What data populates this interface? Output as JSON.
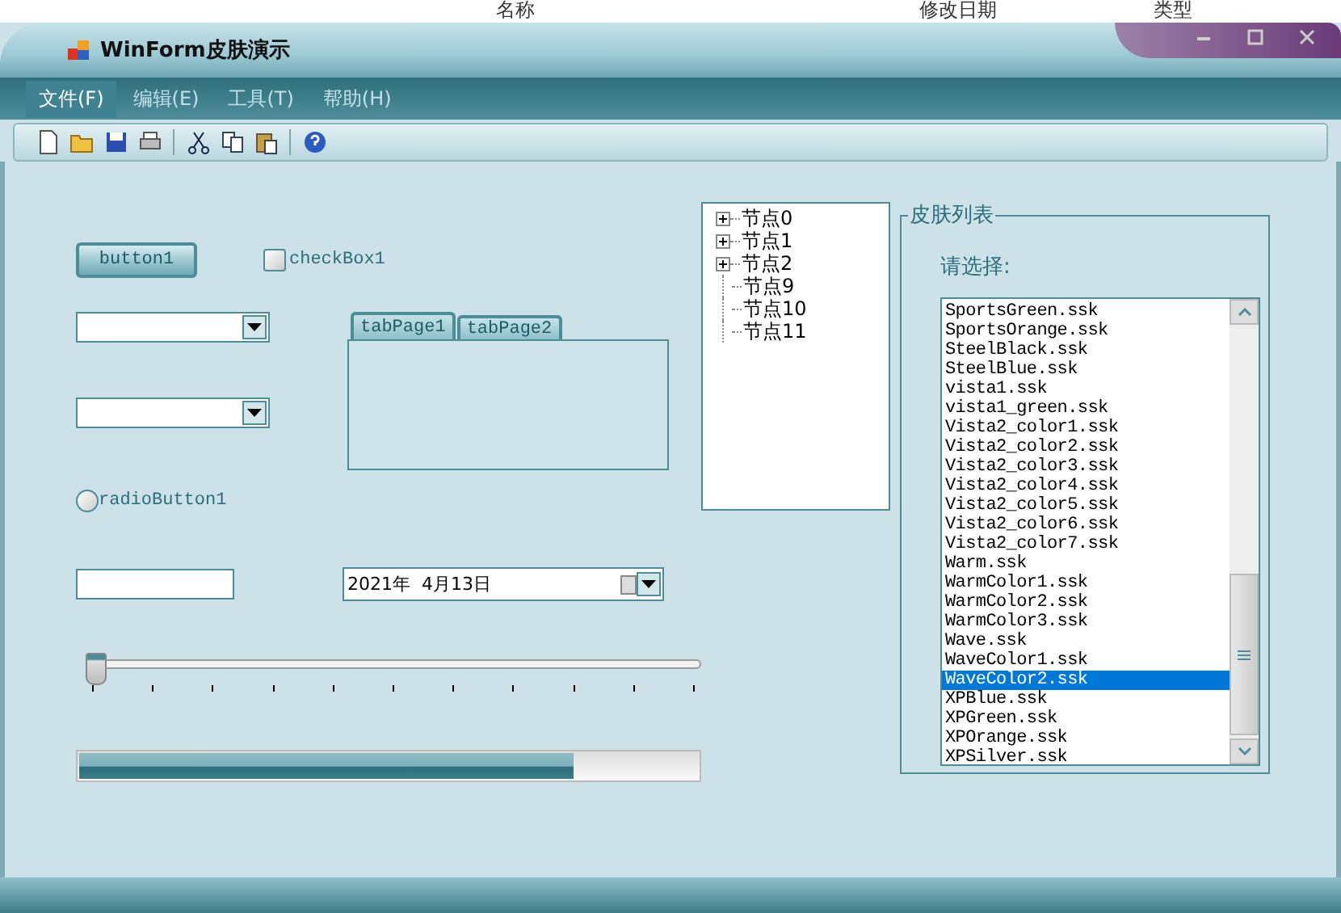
{
  "background_window": {
    "columns": [
      "名称",
      "修改日期",
      "类型"
    ]
  },
  "window": {
    "title": "WinForm皮肤演示"
  },
  "menu": [
    {
      "label": "文件(F)",
      "selected": true
    },
    {
      "label": "编辑(E)",
      "selected": false
    },
    {
      "label": "工具(T)",
      "selected": false
    },
    {
      "label": "帮助(H)",
      "selected": false
    }
  ],
  "toolbar": [
    {
      "kind": "new"
    },
    {
      "kind": "open"
    },
    {
      "kind": "save"
    },
    {
      "kind": "print"
    },
    {
      "kind": "separator"
    },
    {
      "kind": "cut"
    },
    {
      "kind": "copy"
    },
    {
      "kind": "paste"
    },
    {
      "kind": "separator"
    },
    {
      "kind": "help"
    }
  ],
  "button": {
    "label": "button1"
  },
  "checkbox": {
    "label": "checkBox1",
    "checked": false
  },
  "tabs": [
    {
      "label": "tabPage1",
      "selected": true
    },
    {
      "label": "tabPage2",
      "selected": false
    }
  ],
  "radio": {
    "label": "radioButton1",
    "checked": false
  },
  "date_picker": {
    "value": "2021年  4月13日"
  },
  "slider": {
    "level": 0
  },
  "progress": {
    "level": 0.8
  },
  "tree": [
    {
      "label": "节点0",
      "has_children": true
    },
    {
      "label": "节点1",
      "has_children": true
    },
    {
      "label": "节点2",
      "has_children": true
    },
    {
      "label": "节点9",
      "has_children": false
    },
    {
      "label": "节点10",
      "has_children": false
    },
    {
      "label": "节点11",
      "has_children": false
    }
  ],
  "skin_group": {
    "title": "皮肤列表",
    "prompt": "请选择:",
    "items": [
      {
        "label": "SportsGreen.ssk",
        "selected": false
      },
      {
        "label": "SportsOrange.ssk",
        "selected": false
      },
      {
        "label": "SteelBlack.ssk",
        "selected": false
      },
      {
        "label": "SteelBlue.ssk",
        "selected": false
      },
      {
        "label": "vista1.ssk",
        "selected": false
      },
      {
        "label": "vista1_green.ssk",
        "selected": false
      },
      {
        "label": "Vista2_color1.ssk",
        "selected": false
      },
      {
        "label": "Vista2_color2.ssk",
        "selected": false
      },
      {
        "label": "Vista2_color3.ssk",
        "selected": false
      },
      {
        "label": "Vista2_color4.ssk",
        "selected": false
      },
      {
        "label": "Vista2_color5.ssk",
        "selected": false
      },
      {
        "label": "Vista2_color6.ssk",
        "selected": false
      },
      {
        "label": "Vista2_color7.ssk",
        "selected": false
      },
      {
        "label": "Warm.ssk",
        "selected": false
      },
      {
        "label": "WarmColor1.ssk",
        "selected": false
      },
      {
        "label": "WarmColor2.ssk",
        "selected": false
      },
      {
        "label": "WarmColor3.ssk",
        "selected": false
      },
      {
        "label": "Wave.ssk",
        "selected": false
      },
      {
        "label": "WaveColor1.ssk",
        "selected": false
      },
      {
        "label": "WaveColor2.ssk",
        "selected": true
      },
      {
        "label": "XPBlue.ssk",
        "selected": false
      },
      {
        "label": "XPGreen.ssk",
        "selected": false
      },
      {
        "label": "XPOrange.ssk",
        "selected": false
      },
      {
        "label": "XPSilver.ssk",
        "selected": false
      }
    ]
  }
}
